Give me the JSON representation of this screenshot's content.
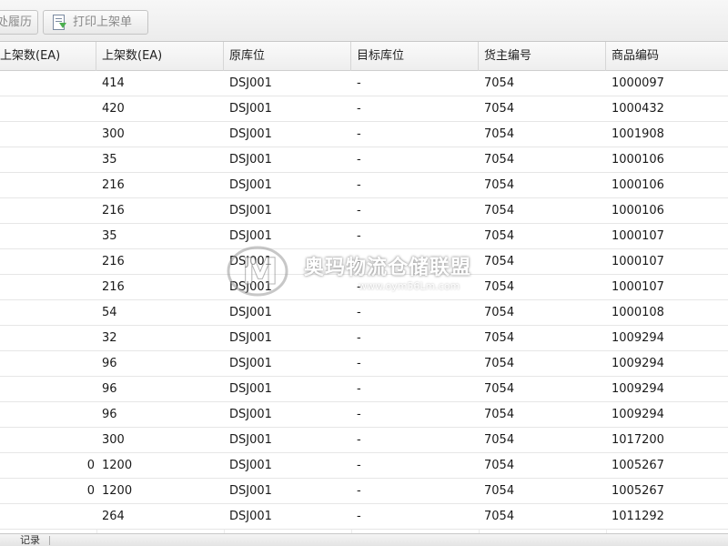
{
  "toolbar": {
    "history_label": "处履历",
    "print_label": "打印上架单"
  },
  "columns": [
    "上架数(EA)",
    "上架数(EA)",
    "原库位",
    "目标库位",
    "货主编号",
    "商品编码"
  ],
  "rows": [
    [
      "",
      "414",
      "DSJ001",
      "-",
      "7054",
      "1000097"
    ],
    [
      "",
      "420",
      "DSJ001",
      "-",
      "7054",
      "1000432"
    ],
    [
      "",
      "300",
      "DSJ001",
      "-",
      "7054",
      "1001908"
    ],
    [
      "",
      "35",
      "DSJ001",
      "-",
      "7054",
      "1000106"
    ],
    [
      "",
      "216",
      "DSJ001",
      "-",
      "7054",
      "1000106"
    ],
    [
      "",
      "216",
      "DSJ001",
      "-",
      "7054",
      "1000106"
    ],
    [
      "",
      "35",
      "DSJ001",
      "-",
      "7054",
      "1000107"
    ],
    [
      "",
      "216",
      "DSJ001",
      "-",
      "7054",
      "1000107"
    ],
    [
      "",
      "216",
      "DSJ001",
      "-",
      "7054",
      "1000107"
    ],
    [
      "",
      "54",
      "DSJ001",
      "-",
      "7054",
      "1000108"
    ],
    [
      "",
      "32",
      "DSJ001",
      "-",
      "7054",
      "1009294"
    ],
    [
      "",
      "96",
      "DSJ001",
      "-",
      "7054",
      "1009294"
    ],
    [
      "",
      "96",
      "DSJ001",
      "-",
      "7054",
      "1009294"
    ],
    [
      "",
      "96",
      "DSJ001",
      "-",
      "7054",
      "1009294"
    ],
    [
      "",
      "300",
      "DSJ001",
      "-",
      "7054",
      "1017200"
    ],
    [
      "0",
      "1200",
      "DSJ001",
      "-",
      "7054",
      "1005267"
    ],
    [
      "0",
      "1200",
      "DSJ001",
      "-",
      "7054",
      "1005267"
    ],
    [
      "",
      "264",
      "DSJ001",
      "-",
      "7054",
      "1011292"
    ]
  ],
  "watermark": {
    "text": "奥玛物流仓储联盟",
    "url": "www.oym56Lm.com"
  },
  "statusbar": {
    "text": "记录"
  }
}
